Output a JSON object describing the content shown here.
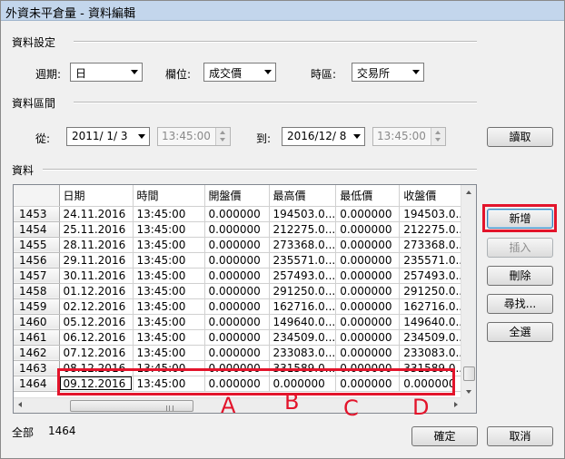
{
  "window": {
    "title": "外資未平倉量 - 資料編輯"
  },
  "settings": {
    "group_label": "資料設定",
    "period_label": "週期:",
    "period_value": "日",
    "field_label": "欄位:",
    "field_value": "成交價",
    "timezone_label": "時區:",
    "timezone_value": "交易所"
  },
  "range": {
    "group_label": "資料區間",
    "from_label": "從:",
    "from_date": "2011/ 1/ 3",
    "from_time": "13:45:00",
    "to_label": "到:",
    "to_date": "2016/12/ 8",
    "to_time": "13:45:00",
    "read_button": "讀取"
  },
  "data_section": {
    "group_label": "資料",
    "columns": [
      "日期",
      "時間",
      "開盤價",
      "最高價",
      "最低價",
      "收盤價"
    ],
    "rows": [
      {
        "n": "1453",
        "date": "24.11.2016",
        "time": "13:45:00",
        "open": "0.000000",
        "high": "194503.0...",
        "low": "0.000000",
        "close": "194503.0..."
      },
      {
        "n": "1454",
        "date": "25.11.2016",
        "time": "13:45:00",
        "open": "0.000000",
        "high": "212275.0...",
        "low": "0.000000",
        "close": "212275.0..."
      },
      {
        "n": "1455",
        "date": "28.11.2016",
        "time": "13:45:00",
        "open": "0.000000",
        "high": "273368.0...",
        "low": "0.000000",
        "close": "273368.0..."
      },
      {
        "n": "1456",
        "date": "29.11.2016",
        "time": "13:45:00",
        "open": "0.000000",
        "high": "235571.0...",
        "low": "0.000000",
        "close": "235571.0..."
      },
      {
        "n": "1457",
        "date": "30.11.2016",
        "time": "13:45:00",
        "open": "0.000000",
        "high": "257493.0...",
        "low": "0.000000",
        "close": "257493.0..."
      },
      {
        "n": "1458",
        "date": "01.12.2016",
        "time": "13:45:00",
        "open": "0.000000",
        "high": "291250.0...",
        "low": "0.000000",
        "close": "291250.0..."
      },
      {
        "n": "1459",
        "date": "02.12.2016",
        "time": "13:45:00",
        "open": "0.000000",
        "high": "162716.0...",
        "low": "0.000000",
        "close": "162716.0..."
      },
      {
        "n": "1460",
        "date": "05.12.2016",
        "time": "13:45:00",
        "open": "0.000000",
        "high": "149640.0...",
        "low": "0.000000",
        "close": "149640.0..."
      },
      {
        "n": "1461",
        "date": "06.12.2016",
        "time": "13:45:00",
        "open": "0.000000",
        "high": "234509.0...",
        "low": "0.000000",
        "close": "234509.0..."
      },
      {
        "n": "1462",
        "date": "07.12.2016",
        "time": "13:45:00",
        "open": "0.000000",
        "high": "233083.0...",
        "low": "0.000000",
        "close": "233083.0..."
      },
      {
        "n": "1463",
        "date": "08.12.2016",
        "time": "13:45:00",
        "open": "0.000000",
        "high": "331589.0...",
        "low": "0.000000",
        "close": "331589.0..."
      },
      {
        "n": "1464",
        "date": "09.12.2016",
        "time": "13:45:00",
        "open": "0.000000",
        "high": "0.000000",
        "low": "0.000000",
        "close": "0.000000"
      }
    ]
  },
  "side_buttons": {
    "add": "新增",
    "insert": "插入",
    "delete": "刪除",
    "find": "尋找...",
    "select_all": "全選"
  },
  "footer": {
    "total_label": "全部",
    "total_count": "1464",
    "ok": "確定",
    "cancel": "取消"
  },
  "annotations": [
    "A",
    "B",
    "C",
    "D"
  ],
  "colors": {
    "highlight": "#e3142b",
    "titlebar": "#c3d6ec"
  }
}
